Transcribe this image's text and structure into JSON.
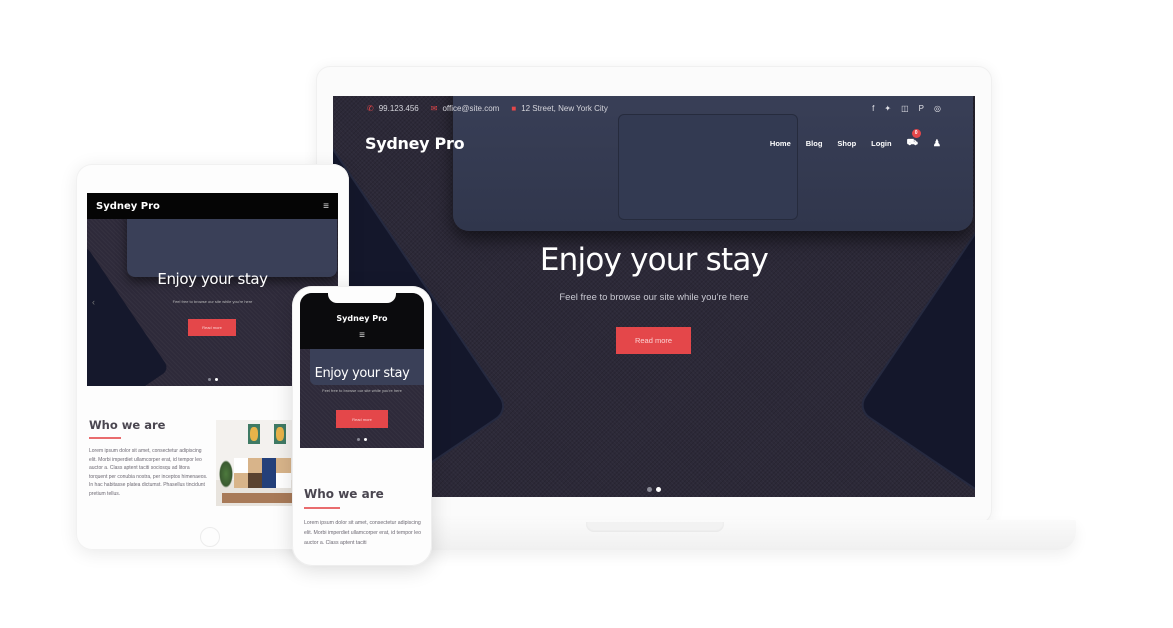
{
  "site": {
    "brand": "Sydney Pro",
    "accent_color": "#e4474a",
    "topbar": {
      "phone": "99.123.456",
      "email": "office@site.com",
      "address": "12 Street, New York City",
      "phone_icon": "phone-icon",
      "email_icon": "envelope-icon",
      "address_icon": "map-marker-icon",
      "socials": [
        {
          "name": "facebook-icon",
          "glyph": "f"
        },
        {
          "name": "twitter-icon",
          "glyph": "🐦"
        },
        {
          "name": "instagram-icon",
          "glyph": "◫"
        },
        {
          "name": "pinterest-icon",
          "glyph": "P"
        },
        {
          "name": "dribbble-icon",
          "glyph": "◎"
        }
      ]
    },
    "nav": {
      "items": [
        "Home",
        "Blog",
        "Shop",
        "Login"
      ],
      "cart_icon": "🛒",
      "cart_count": "0",
      "user_icon": "👤",
      "hamburger_icon": "≡"
    },
    "hero": {
      "title": "Enjoy your stay",
      "subtitle": "Feel free to browse our site while you're here",
      "button": "Read more",
      "prev_arrow": "‹",
      "slide_count": 2,
      "active_slide": 2
    },
    "about": {
      "title": "Who we are",
      "text": "Lorem ipsum dolor sit amet, consectetur adipiscing elit. Morbi imperdiet ullamcorper erat, id tempor leo auctor a. Class aptent taciti sociosqu ad litora torquent per conubia nostra, per inceptos himenaeos. In hac habitasse platea dictumst. Phasellus tincidunt pretium tellus.",
      "text_phone": "Lorem ipsum dolor sit amet, consectetur adipiscing elit. Morbi imperdiet ullamcorper erat, id tempor leo auctor a. Class aptent taciti"
    }
  }
}
